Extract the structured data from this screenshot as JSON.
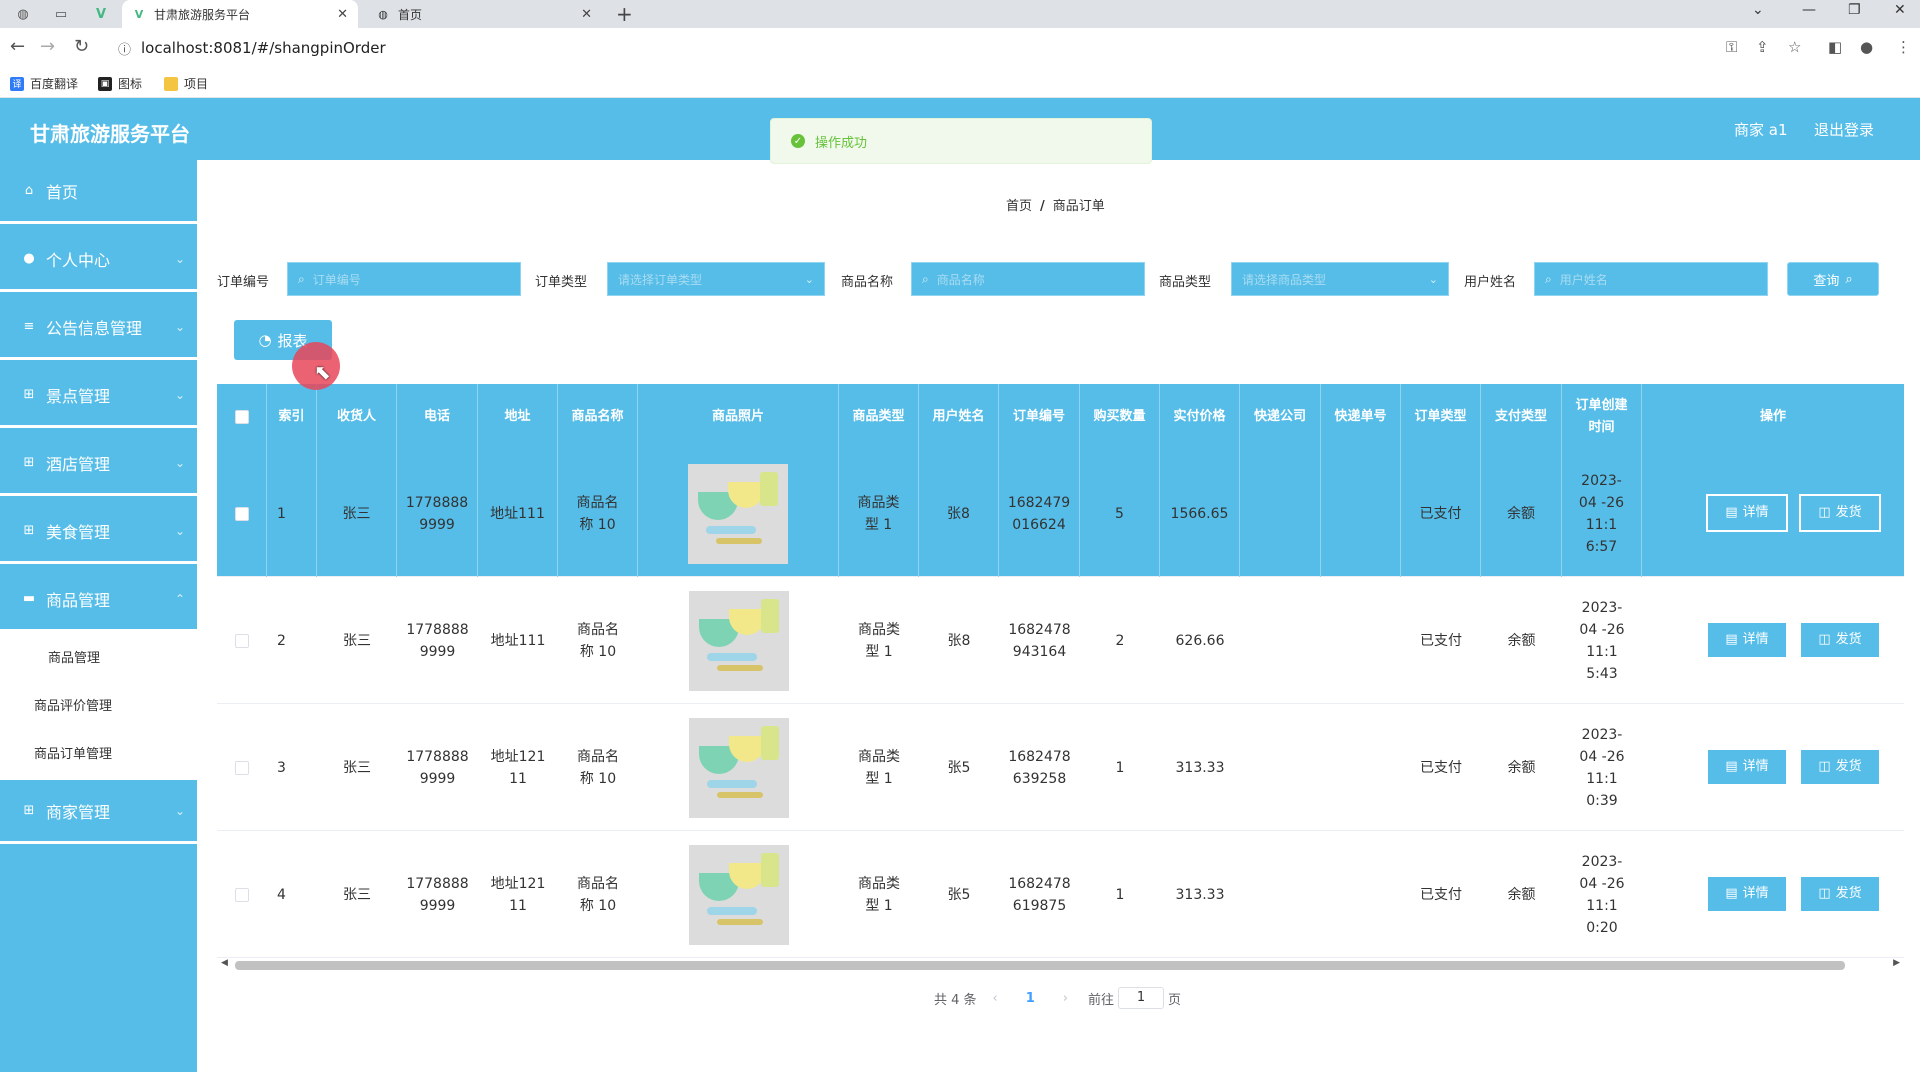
{
  "browser": {
    "tabs": [
      {
        "title": "甘肃旅游服务平台",
        "active": true
      },
      {
        "title": "首页",
        "active": false
      }
    ],
    "url": "localhost:8081/#/shangpinOrder",
    "bookmarks": [
      "百度翻译",
      "图标",
      "项目"
    ]
  },
  "app": {
    "title": "甘肃旅游服务平台",
    "user": "商家 a1",
    "logout": "退出登录",
    "toast": "操作成功",
    "accent_color": "#56bde8"
  },
  "sidebar": {
    "items": [
      {
        "label": "首页",
        "icon": "home-icon"
      },
      {
        "label": "个人中心",
        "icon": "user-icon"
      },
      {
        "label": "公告信息管理",
        "icon": "list-icon"
      },
      {
        "label": "景点管理",
        "icon": "grid-icon"
      },
      {
        "label": "酒店管理",
        "icon": "grid-icon"
      },
      {
        "label": "美食管理",
        "icon": "grid-icon"
      },
      {
        "label": "商品管理",
        "icon": "comment-icon"
      },
      {
        "label": "商家管理",
        "icon": "grid-icon"
      }
    ],
    "submenu": [
      "商品管理",
      "商品评价管理",
      "商品订单管理"
    ]
  },
  "breadcrumb": {
    "home": "首页",
    "current": "商品订单"
  },
  "search": {
    "fields": [
      {
        "label": "订单编号",
        "placeholder": "订单编号"
      },
      {
        "label": "订单类型",
        "placeholder": "请选择订单类型"
      },
      {
        "label": "商品名称",
        "placeholder": "商品名称"
      },
      {
        "label": "商品类型",
        "placeholder": "请选择商品类型"
      },
      {
        "label": "用户姓名",
        "placeholder": "用户姓名"
      }
    ],
    "query_label": "查询"
  },
  "report_label": "报表",
  "table": {
    "headers": [
      "索引",
      "收货人",
      "电话",
      "地址",
      "商品名称",
      "商品照片",
      "商品类型",
      "用户姓名",
      "订单编号",
      "购买数量",
      "实付价格",
      "快递公司",
      "快递单号",
      "订单类型",
      "支付类型",
      "订单创建时间",
      "操作"
    ],
    "detail_label": "详情",
    "ship_label": "发货",
    "rows": [
      {
        "index": "1",
        "receiver": "张三",
        "phone": "1778888 9999",
        "address": "地址111",
        "name": "商品名称 10",
        "type": "商品类型 1",
        "user": "张8",
        "order_no": "1682479 016624",
        "qty": "5",
        "price": "1566.65",
        "company": "",
        "tracking": "",
        "order_type": "已支付",
        "pay_type": "余额",
        "created": "2023-04 -26 11:1 6:57"
      },
      {
        "index": "2",
        "receiver": "张三",
        "phone": "1778888 9999",
        "address": "地址111",
        "name": "商品名称 10",
        "type": "商品类型 1",
        "user": "张8",
        "order_no": "1682478 943164",
        "qty": "2",
        "price": "626.66",
        "company": "",
        "tracking": "",
        "order_type": "已支付",
        "pay_type": "余额",
        "created": "2023-04 -26 11:1 5:43"
      },
      {
        "index": "3",
        "receiver": "张三",
        "phone": "1778888 9999",
        "address": "地址121 11",
        "name": "商品名称 10",
        "type": "商品类型 1",
        "user": "张5",
        "order_no": "1682478 639258",
        "qty": "1",
        "price": "313.33",
        "company": "",
        "tracking": "",
        "order_type": "已支付",
        "pay_type": "余额",
        "created": "2023-04 -26 11:1 0:39"
      },
      {
        "index": "4",
        "receiver": "张三",
        "phone": "1778888 9999",
        "address": "地址121 11",
        "name": "商品名称 10",
        "type": "商品类型 1",
        "user": "张5",
        "order_no": "1682478 619875",
        "qty": "1",
        "price": "313.33",
        "company": "",
        "tracking": "",
        "order_type": "已支付",
        "pay_type": "余额",
        "created": "2023-04 -26 11:1 0:20"
      }
    ]
  },
  "pager": {
    "total": "共 4 条",
    "page": "1",
    "goto": "前往",
    "goto_value": "1",
    "unit": "页"
  }
}
